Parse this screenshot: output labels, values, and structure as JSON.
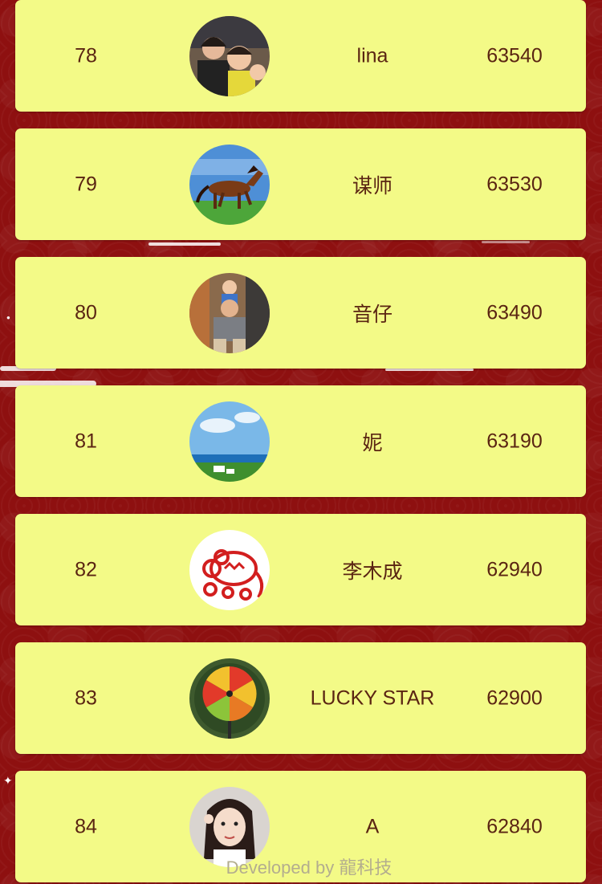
{
  "leaderboard": {
    "rows": [
      {
        "rank": "78",
        "name": "lina",
        "score": "63540",
        "avatar": "family-photo-avatar"
      },
      {
        "rank": "79",
        "name": "谋师",
        "score": "63530",
        "avatar": "horse-avatar"
      },
      {
        "rank": "80",
        "name": "音仔",
        "score": "63490",
        "avatar": "father-child-avatar"
      },
      {
        "rank": "81",
        "name": "妮",
        "score": "63190",
        "avatar": "seaside-avatar"
      },
      {
        "rank": "82",
        "name": "李木成",
        "score": "62940",
        "avatar": "paper-cut-rat-avatar"
      },
      {
        "rank": "83",
        "name": "LUCKY STAR",
        "score": "62900",
        "avatar": "prize-wheel-avatar"
      },
      {
        "rank": "84",
        "name": "A",
        "score": "62840",
        "avatar": "girl-portrait-avatar"
      }
    ]
  },
  "footer": {
    "credit": "Developed by 龍科技"
  },
  "colors": {
    "background": "#8e1010",
    "card": "#f3fa87",
    "text": "#5a2412",
    "footer_text": "#b3ad8e"
  }
}
